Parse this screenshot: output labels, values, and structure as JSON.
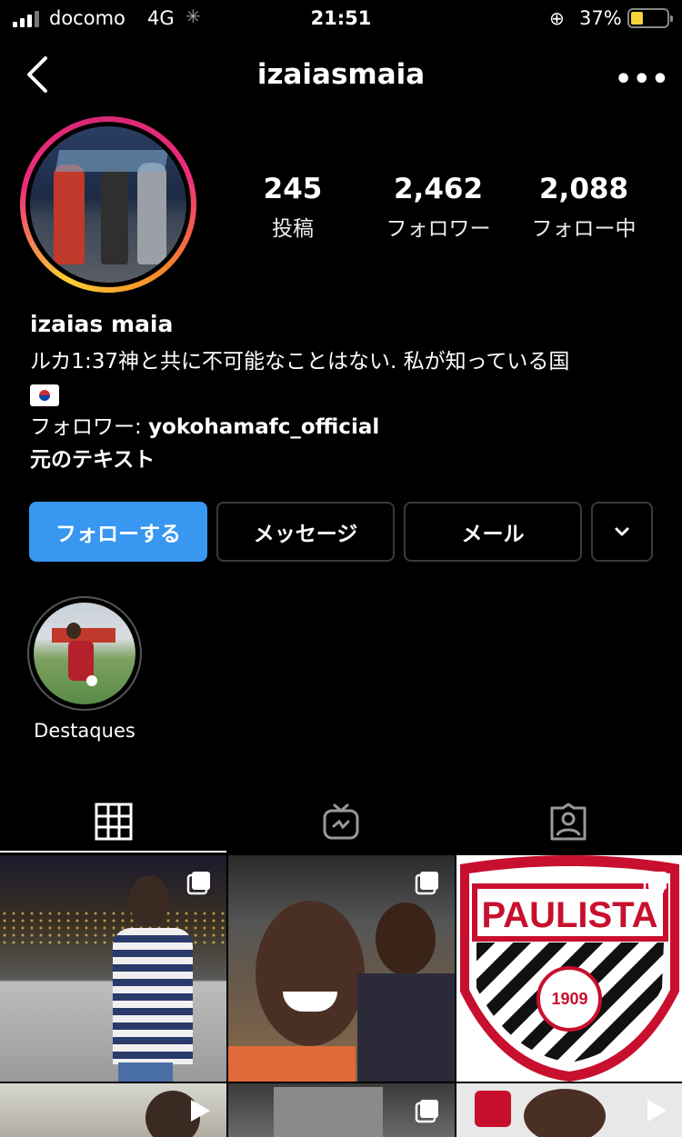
{
  "status_bar": {
    "carrier": "docomo",
    "network": "4G",
    "time": "21:51",
    "battery_percent": "37%",
    "battery_level": 0.37
  },
  "header": {
    "username": "izaiasmaia",
    "back_icon": "chevron-left-icon",
    "more_icon": "ellipsis-icon",
    "more_glyph": "•••"
  },
  "stats": [
    {
      "value": "245",
      "label": "投稿"
    },
    {
      "value": "2,462",
      "label": "フォロワー"
    },
    {
      "value": "2,088",
      "label": "フォロー中"
    }
  ],
  "bio": {
    "full_name": "izaias maia",
    "line1": "ルカ1:37神と共に不可能なことはない. 私が知っている国",
    "followed_by_prefix": "フォロワー: ",
    "followed_by_user": "yokohamafc_official",
    "translate_link": "元のテキスト"
  },
  "buttons": {
    "follow": "フォローする",
    "message": "メッセージ",
    "email": "メール",
    "more_icon": "chevron-down-icon"
  },
  "highlights": [
    {
      "label": "Destaques"
    }
  ],
  "tabs": [
    {
      "name": "grid",
      "icon": "grid-icon",
      "active": true
    },
    {
      "name": "igtv",
      "icon": "igtv-icon",
      "active": false
    },
    {
      "name": "tagged",
      "icon": "tagged-person-icon",
      "active": false
    }
  ],
  "posts": [
    {
      "kind": "multi"
    },
    {
      "kind": "multi"
    },
    {
      "kind": "multi"
    },
    {
      "kind": "video"
    },
    {
      "kind": "multi"
    },
    {
      "kind": "video"
    }
  ],
  "colors": {
    "background": "#000000",
    "follow_button": "#3897f0",
    "battery": "#f6d33a"
  },
  "post_texts": {
    "paulista": "PAULISTA",
    "year": "1909"
  }
}
